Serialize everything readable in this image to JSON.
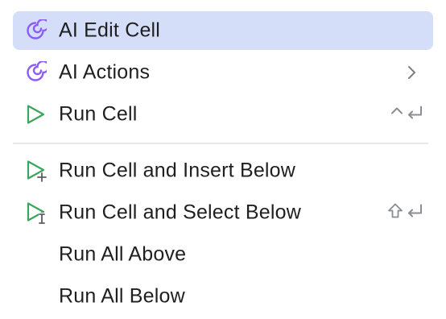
{
  "menu": {
    "items": [
      {
        "label": "AI Edit Cell",
        "icon": "ai-spiral-icon",
        "selected": true
      },
      {
        "label": "AI Actions",
        "icon": "ai-spiral-icon",
        "submenu_indicator": "chevron-right-icon"
      },
      {
        "label": "Run Cell",
        "icon": "run-triangle-icon",
        "shortcut_icons": [
          "control-caret-icon",
          "return-icon"
        ]
      },
      {
        "label": "Run Cell and Insert Below",
        "icon": "run-insert-below-icon"
      },
      {
        "label": "Run Cell and Select Below",
        "icon": "run-select-below-icon",
        "shortcut_icons": [
          "shift-arrow-icon",
          "return-icon"
        ]
      },
      {
        "label": "Run All Above"
      },
      {
        "label": "Run All Below"
      }
    ]
  },
  "colors": {
    "selected_bg": "#d5def9",
    "ai_icon": "#8b5cf6",
    "run_icon": "#3aa55c",
    "text": "#1f1f1f",
    "shortcut": "#8a8d93",
    "separator": "#e6e7ea"
  }
}
